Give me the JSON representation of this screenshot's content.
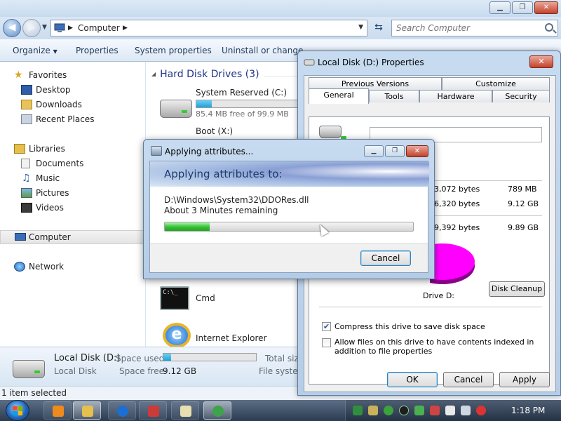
{
  "explorer": {
    "address": {
      "segments": [
        "Computer"
      ]
    },
    "search": {
      "placeholder": "Search Computer"
    },
    "toolbar": {
      "organize": "Organize",
      "properties": "Properties",
      "system_properties": "System properties",
      "uninstall": "Uninstall or change"
    },
    "nav": {
      "favorites": "Favorites",
      "desktop": "Desktop",
      "downloads": "Downloads",
      "recent_places": "Recent Places",
      "libraries": "Libraries",
      "documents": "Documents",
      "music": "Music",
      "pictures": "Pictures",
      "videos": "Videos",
      "computer": "Computer",
      "network": "Network"
    },
    "content": {
      "group_header": "Hard Disk Drives (3)",
      "drives": [
        {
          "name": "System Reserved (C:)",
          "free": "85.4 MB free of 99.9 MB",
          "used_fraction": 0.15
        },
        {
          "name": "Boot (X:)"
        }
      ],
      "items": [
        {
          "name": "Cmd",
          "icon": "cmd-icon"
        },
        {
          "name": "Internet Explorer",
          "icon": "ie-icon"
        }
      ]
    },
    "details": {
      "name": "Local Disk (D:)",
      "type": "Local Disk",
      "space_used_label": "Space used:",
      "space_free_label": "Space free:",
      "space_free": "9.12 GB",
      "total_size_label": "Total siz",
      "filesystem_label": "File system",
      "used_fraction": 0.08
    },
    "status": {
      "selected": "1 item selected"
    }
  },
  "props": {
    "title": "Local Disk (D:) Properties",
    "close": "X",
    "tabs_top": [
      "Previous Versions",
      "Customize"
    ],
    "tabs_bottom": [
      "General",
      "Tools",
      "Hardware",
      "Security"
    ],
    "rows": [
      {
        "bytes": "3,072 bytes",
        "size": "789 MB"
      },
      {
        "bytes": "6,320 bytes",
        "size": "9.12 GB"
      },
      {
        "bytes": "9,392 bytes",
        "size": "9.89 GB"
      }
    ],
    "drive_label": "Drive D:",
    "disk_cleanup": "Disk Cleanup",
    "compress": "Compress this drive to save disk space",
    "index": "Allow files on this drive to have contents indexed in addition to file properties",
    "compress_checked": true,
    "index_checked": false,
    "ok": "OK",
    "cancel": "Cancel",
    "apply": "Apply",
    "pie_color": "#ff00ff"
  },
  "apply_dialog": {
    "title": "Applying attributes...",
    "heading": "Applying attributes to:",
    "file": "D:\\Windows\\System32\\DDORes.dll",
    "remaining": "About 3 Minutes remaining",
    "progress": 0.18,
    "cancel": "Cancel"
  },
  "taskbar": {
    "clock": "1:18 PM"
  }
}
